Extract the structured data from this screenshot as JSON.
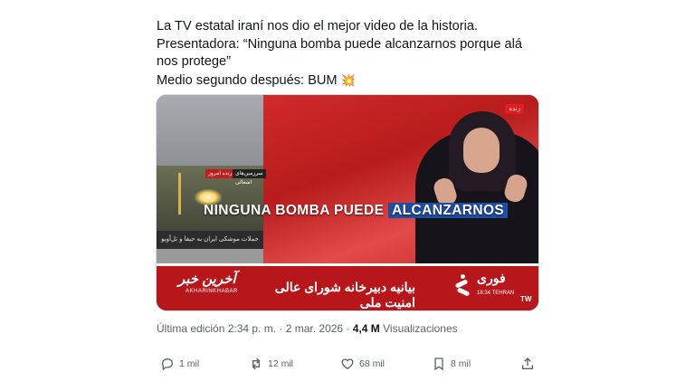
{
  "tweet": {
    "lines": [
      "La TV estatal iraní nos dio el mejor video de la historia.",
      "Presentadora: “Ninguna bomba puede alcanzarnos porque alá nos protege”",
      "Medio segundo después: BUM"
    ],
    "emoji": "💥"
  },
  "video": {
    "caption_part1": "NINGUNA BOMBA PUEDE",
    "caption_part2": "ALCANZARNOS",
    "live_badge": "زنده",
    "left_caption": "حملات موشکی ایران به حیفا و تل‌آویو",
    "tag1": "زنده امروز",
    "tag2": "سرزمین‌های اشغالی",
    "logo_text": "آخرین خبر",
    "logo_sub": "AKHARINKHABAR",
    "ticker": "بیانیه دبیرخانه شورای عالی امنیت ملی",
    "fouri_title": "فوری",
    "fouri_time": "18:34 TEHRAN",
    "tw_mark": "TW"
  },
  "meta": {
    "edited": "Última edición 2:34 p. m. · 2 mar. 2026 ·",
    "views_count": "4,4 M",
    "views_label": "Visualizaciones"
  },
  "actions": {
    "replies": "1 mil",
    "reposts": "12 mil",
    "likes": "68 mil",
    "bookmarks": "8 mil"
  },
  "colors": {
    "accent_red": "#b7161b",
    "caption_highlight": "#1e4fa8",
    "muted_text": "#536471"
  }
}
